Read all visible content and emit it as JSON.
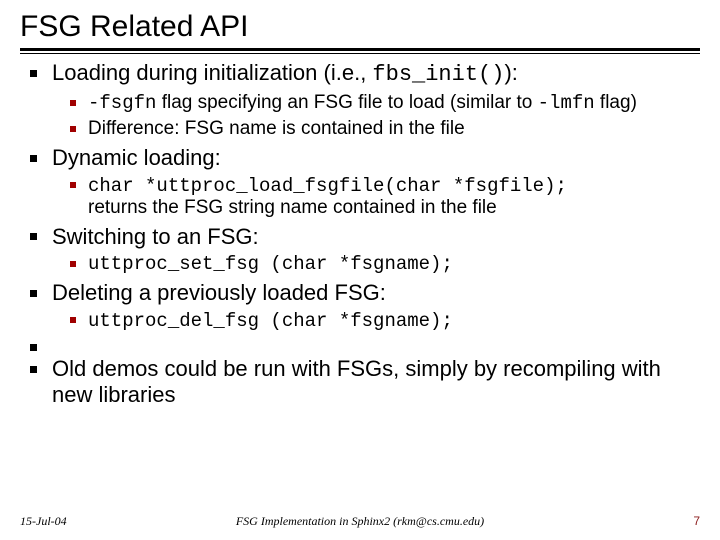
{
  "title": "FSG Related API",
  "bullets": {
    "b0": {
      "pre": "Loading during initialization (i.e., ",
      "code": "fbs_init()",
      "post": "):",
      "sub": {
        "s0": {
          "code0": "-fsgfn",
          "mid": " flag specifying an FSG file to load (similar to ",
          "code1": "-lmfn",
          "post": " flag)"
        },
        "s1": {
          "text": "Difference: FSG name is contained in the file"
        }
      }
    },
    "b1": {
      "text": "Dynamic loading:",
      "sub": {
        "s0": {
          "code": "char *uttproc_load_fsgfile(char *fsgfile);",
          "post": "returns the FSG string name contained in the file"
        }
      }
    },
    "b2": {
      "text": "Switching to an FSG:",
      "sub": {
        "s0": {
          "code": "uttproc_set_fsg (char *fsgname);"
        }
      }
    },
    "b3": {
      "text": "Deleting a previously loaded FSG:",
      "sub": {
        "s0": {
          "code": "uttproc_del_fsg (char *fsgname);"
        }
      }
    },
    "b4": {
      "text": "Old demos could be run with FSGs, simply by recompiling with new libraries"
    }
  },
  "footer": {
    "date": "15-Jul-04",
    "mid": "FSG Implementation in Sphinx2 (rkm@cs.cmu.edu)",
    "page": "7"
  }
}
